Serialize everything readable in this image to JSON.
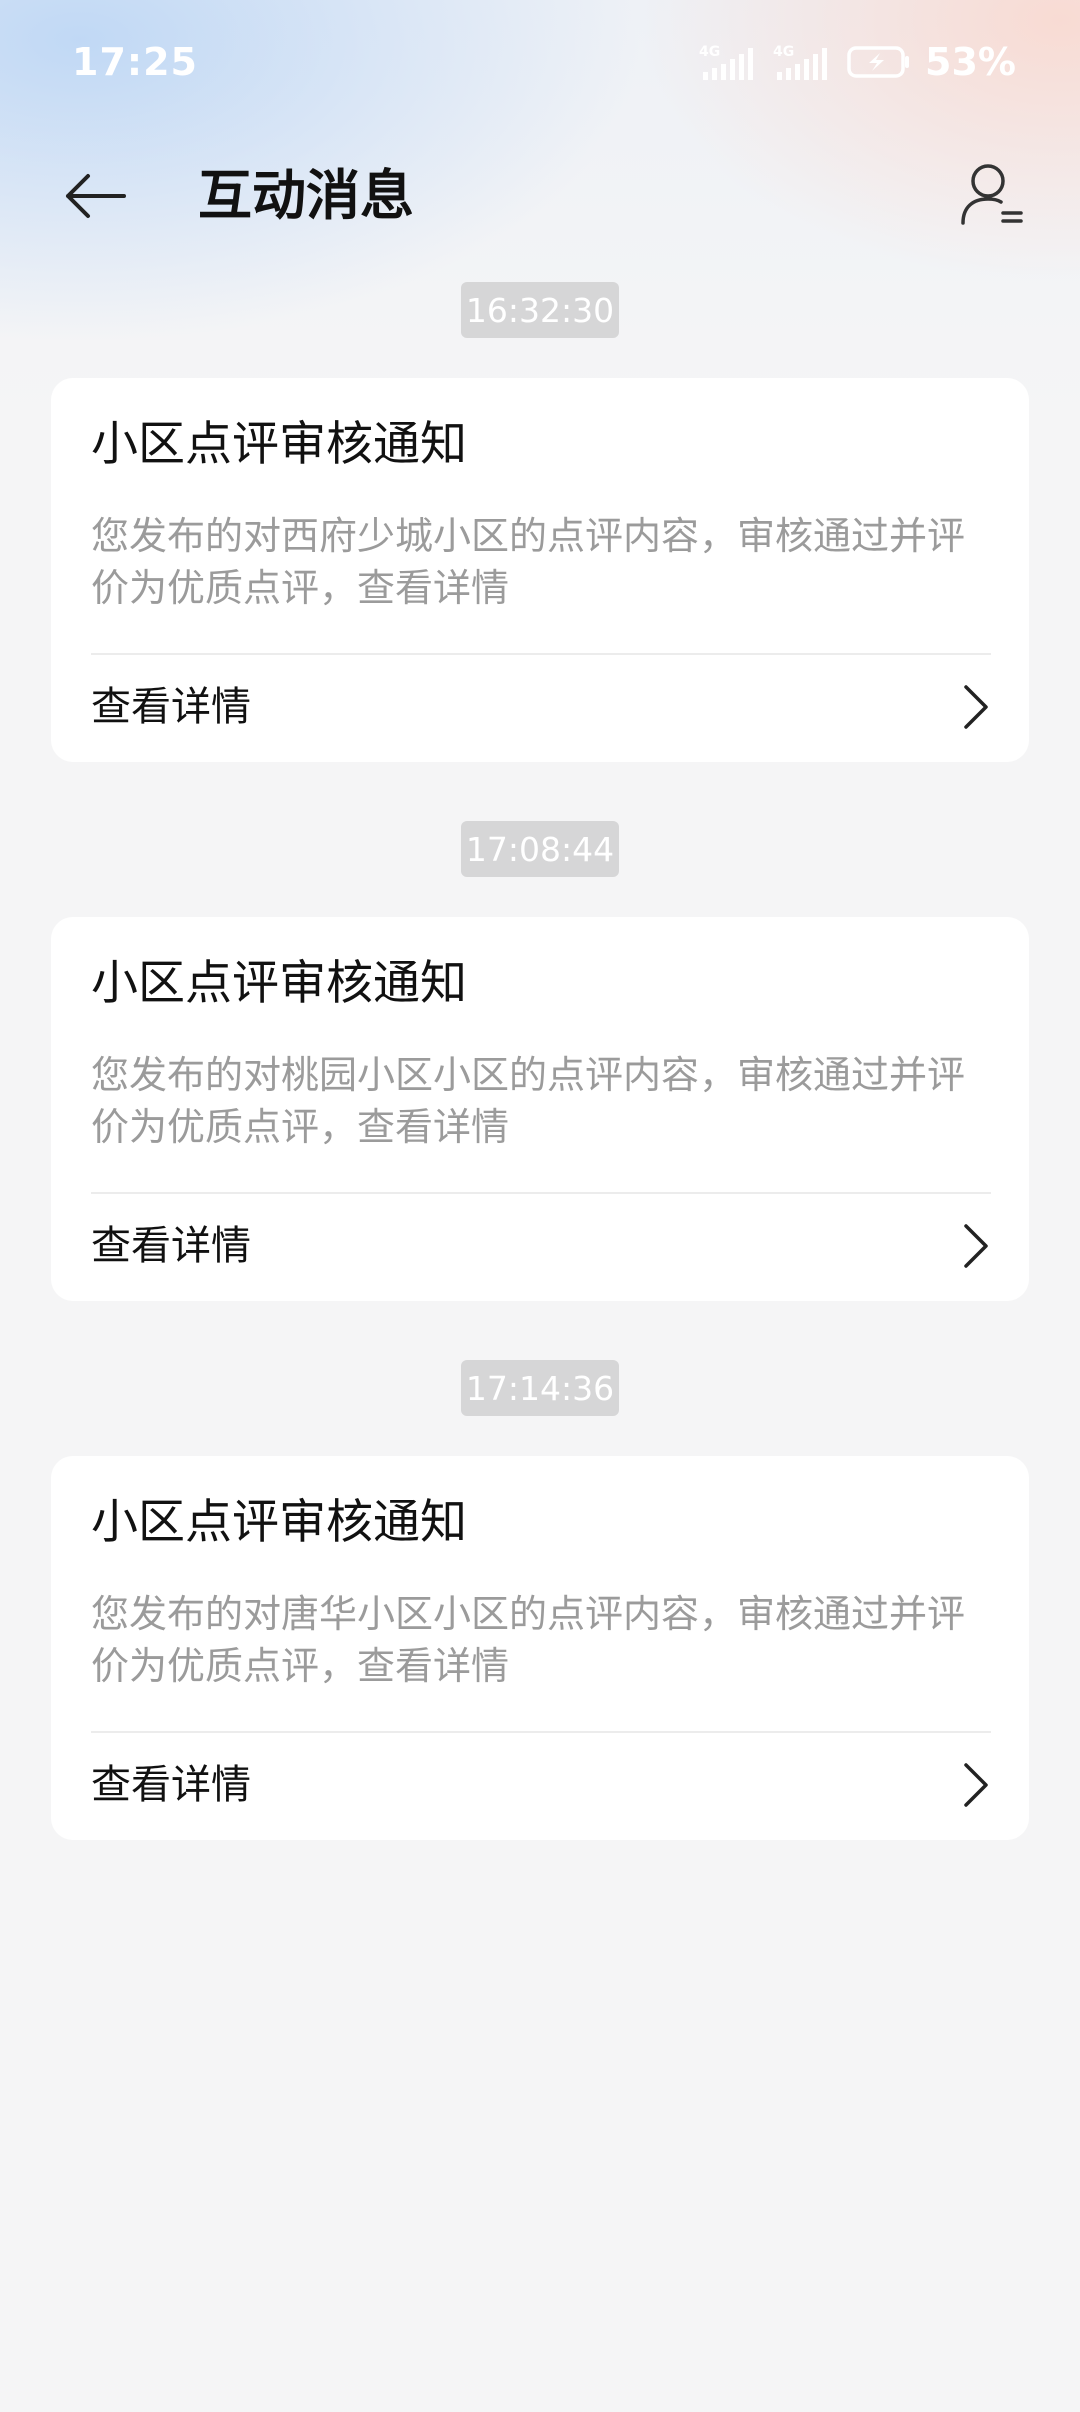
{
  "status_bar": {
    "time": "17:25",
    "battery_percent": "53%",
    "signal_icons": [
      "signal-4g-icon",
      "signal-4g-icon"
    ],
    "battery_icon": "battery-charging-icon"
  },
  "header": {
    "title": "互动消息",
    "back_icon": "back-arrow-icon",
    "profile_icon": "user-list-icon"
  },
  "messages": [
    {
      "time": "16:32:30",
      "title": "小区点评审核通知",
      "description": "您发布的对西府少城小区的点评内容，审核通过并评价为优质点评，查看详情",
      "link_label": "查看详情"
    },
    {
      "time": "17:08:44",
      "title": "小区点评审核通知",
      "description": "您发布的对桃园小区小区的点评内容，审核通过并评价为优质点评，查看详情",
      "link_label": "查看详情"
    },
    {
      "time": "17:14:36",
      "title": "小区点评审核通知",
      "description": "您发布的对唐华小区小区的点评内容，审核通过并评价为优质点评，查看详情",
      "link_label": "查看详情"
    }
  ]
}
